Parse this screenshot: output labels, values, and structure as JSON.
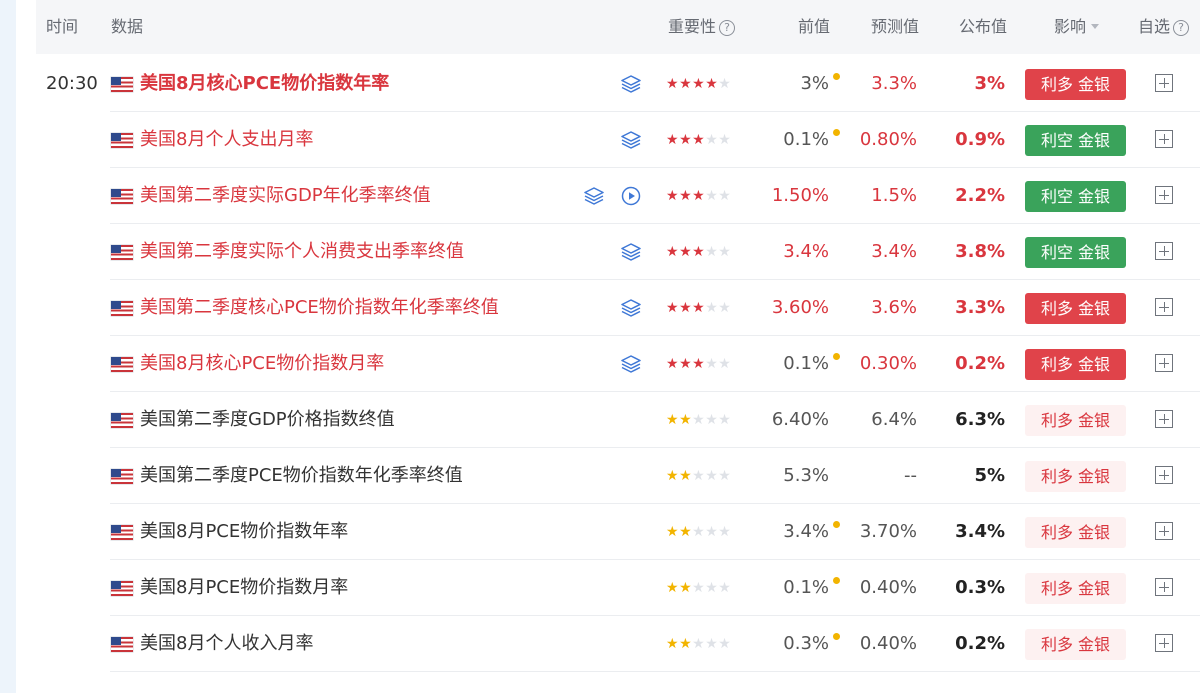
{
  "header": {
    "time": "时间",
    "data": "数据",
    "importance": "重要性",
    "previous": "前值",
    "forecast": "预测值",
    "actual": "公布值",
    "impact": "影响",
    "watchlist": "自选",
    "help_glyph": "?"
  },
  "colors": {
    "accent_red": "#d9363e",
    "bullish_badge": "#e0434a",
    "bearish_badge": "#3aa35b",
    "weak_badge": "#fdf1f1",
    "star_gold": "#f2b400",
    "header_bg": "#f5f6f8"
  },
  "rows": [
    {
      "time": "20:30",
      "name": "美国8月核心PCE物价指数年率",
      "icons": [
        "layers-icon"
      ],
      "stars": 4,
      "previous": "3%",
      "prev_revised": true,
      "forecast": "3.3%",
      "actual": "3%",
      "impact": "利多 金银",
      "impact_type": "bullish"
    },
    {
      "time": "",
      "name": "美国8月个人支出月率",
      "icons": [
        "layers-icon"
      ],
      "stars": 3,
      "previous": "0.1%",
      "prev_revised": true,
      "forecast": "0.80%",
      "actual": "0.9%",
      "impact": "利空 金银",
      "impact_type": "bearish"
    },
    {
      "time": "",
      "name": "美国第二季度实际GDP年化季率终值",
      "icons": [
        "layers-icon",
        "play-icon"
      ],
      "stars": 3,
      "previous": "1.50%",
      "prev_revised": false,
      "forecast": "1.5%",
      "actual": "2.2%",
      "impact": "利空 金银",
      "impact_type": "bearish"
    },
    {
      "time": "",
      "name": "美国第二季度实际个人消费支出季率终值",
      "icons": [
        "layers-icon"
      ],
      "stars": 3,
      "previous": "3.4%",
      "prev_revised": false,
      "forecast": "3.4%",
      "actual": "3.8%",
      "impact": "利空 金银",
      "impact_type": "bearish"
    },
    {
      "time": "",
      "name": "美国第二季度核心PCE物价指数年化季率终值",
      "icons": [
        "layers-icon"
      ],
      "stars": 3,
      "previous": "3.60%",
      "prev_revised": false,
      "forecast": "3.6%",
      "actual": "3.3%",
      "impact": "利多 金银",
      "impact_type": "bullish"
    },
    {
      "time": "",
      "name": "美国8月核心PCE物价指数月率",
      "icons": [
        "layers-icon"
      ],
      "stars": 3,
      "previous": "0.1%",
      "prev_revised": true,
      "forecast": "0.30%",
      "actual": "0.2%",
      "impact": "利多 金银",
      "impact_type": "bullish"
    },
    {
      "time": "",
      "name": "美国第二季度GDP价格指数终值",
      "icons": [],
      "stars": 2,
      "previous": "6.40%",
      "prev_revised": false,
      "forecast": "6.4%",
      "actual": "6.3%",
      "impact": "利多 金银",
      "impact_type": "weak"
    },
    {
      "time": "",
      "name": "美国第二季度PCE物价指数年化季率终值",
      "icons": [],
      "stars": 2,
      "previous": "5.3%",
      "prev_revised": false,
      "forecast": "--",
      "actual": "5%",
      "impact": "利多 金银",
      "impact_type": "weak"
    },
    {
      "time": "",
      "name": "美国8月PCE物价指数年率",
      "icons": [],
      "stars": 2,
      "previous": "3.4%",
      "prev_revised": true,
      "forecast": "3.70%",
      "actual": "3.4%",
      "impact": "利多 金银",
      "impact_type": "weak"
    },
    {
      "time": "",
      "name": "美国8月PCE物价指数月率",
      "icons": [],
      "stars": 2,
      "previous": "0.1%",
      "prev_revised": true,
      "forecast": "0.40%",
      "actual": "0.3%",
      "impact": "利多 金银",
      "impact_type": "weak"
    },
    {
      "time": "",
      "name": "美国8月个人收入月率",
      "icons": [],
      "stars": 2,
      "previous": "0.3%",
      "prev_revised": true,
      "forecast": "0.40%",
      "actual": "0.2%",
      "impact": "利多 金银",
      "impact_type": "weak"
    }
  ]
}
